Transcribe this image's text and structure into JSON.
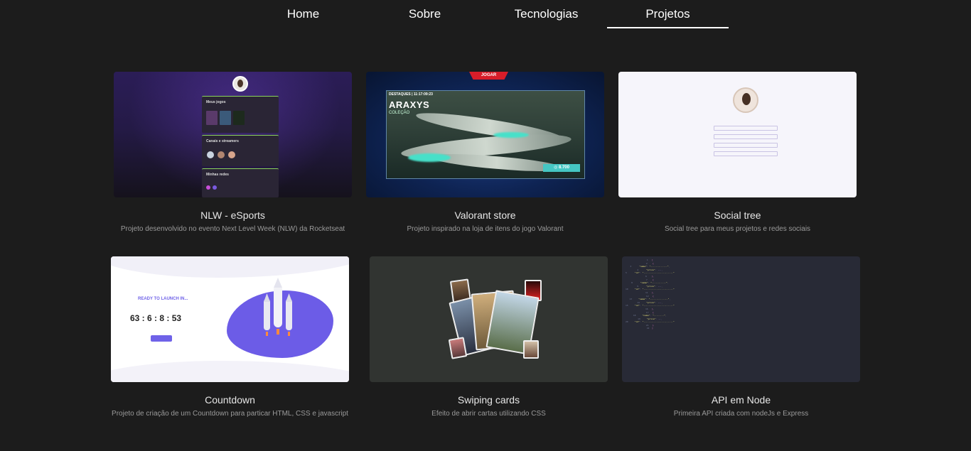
{
  "nav": {
    "items": [
      {
        "label": "Home"
      },
      {
        "label": "Sobre"
      },
      {
        "label": "Tecnologias"
      },
      {
        "label": "Projetos"
      }
    ],
    "active": "Projetos"
  },
  "projects": [
    {
      "title": "NLW - eSports",
      "description": "Projeto desenvolvido no evento Next Level Week (NLW) da Rocketseat",
      "thumb": {
        "panels": [
          "Meus jogos",
          "Canais e streamers",
          "Minhas redes"
        ]
      }
    },
    {
      "title": "Valorant store",
      "description": "Projeto inspirado na loja de itens do jogo Valorant",
      "thumb": {
        "play_label": "JOGAR",
        "featured": "DESTAQUES | 11:17:09:23",
        "item_name": "ARAXYS",
        "item_sub": "COLEÇÃO",
        "price": "8.700"
      }
    },
    {
      "title": "Social tree",
      "description": "Social tree para meus projetos e redes sociais",
      "thumb": {}
    },
    {
      "title": "Countdown",
      "description": "Projeto de criação de um Countdown para particar HTML, CSS e javascript",
      "thumb": {
        "heading": "READY TO LAUNCH IN...",
        "timer": "63 : 6 : 8 : 53"
      }
    },
    {
      "title": "Swiping cards",
      "description": "Efeito de abrir cartas utilizando CSS",
      "thumb": {}
    },
    {
      "title": "API em Node",
      "description": "Primeira API criada com nodeJs e Express",
      "thumb": {}
    }
  ],
  "colors": {
    "background": "#1c1c1c",
    "nav_text": "#ffffff",
    "title_text": "#e6e6e6",
    "desc_text": "#9a9a9a",
    "countdown_accent": "#6c5ce7",
    "valorant_red": "#d71d29"
  }
}
